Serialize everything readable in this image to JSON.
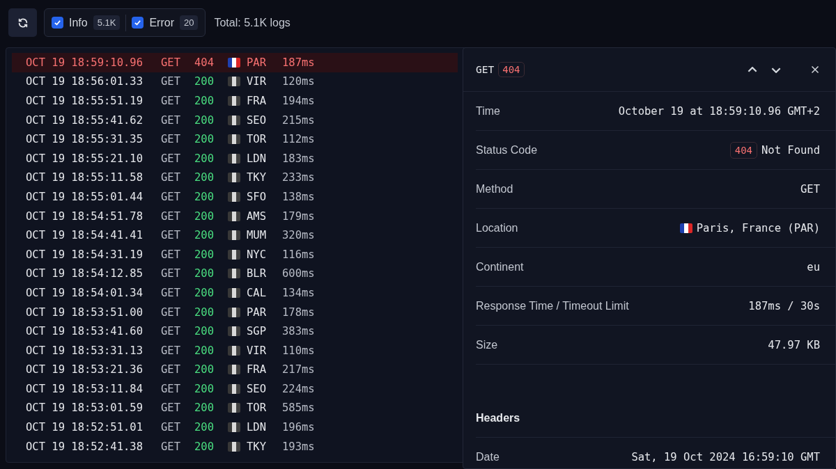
{
  "toolbar": {
    "filters": [
      {
        "label": "Info",
        "count": "5.1K",
        "checked": true
      },
      {
        "label": "Error",
        "count": "20",
        "checked": true
      }
    ],
    "total": "Total: 5.1K logs"
  },
  "logs": [
    {
      "time": "OCT 19 18:59:10.96",
      "method": "GET",
      "status": "404",
      "location": "PAR",
      "duration": "187ms",
      "kind": "error",
      "selected": true
    },
    {
      "time": "OCT 19 18:56:01.33",
      "method": "GET",
      "status": "200",
      "location": "VIR",
      "duration": "120ms",
      "kind": "info",
      "selected": false
    },
    {
      "time": "OCT 19 18:55:51.19",
      "method": "GET",
      "status": "200",
      "location": "FRA",
      "duration": "194ms",
      "kind": "info",
      "selected": false
    },
    {
      "time": "OCT 19 18:55:41.62",
      "method": "GET",
      "status": "200",
      "location": "SEO",
      "duration": "215ms",
      "kind": "info",
      "selected": false
    },
    {
      "time": "OCT 19 18:55:31.35",
      "method": "GET",
      "status": "200",
      "location": "TOR",
      "duration": "112ms",
      "kind": "info",
      "selected": false
    },
    {
      "time": "OCT 19 18:55:21.10",
      "method": "GET",
      "status": "200",
      "location": "LDN",
      "duration": "183ms",
      "kind": "info",
      "selected": false
    },
    {
      "time": "OCT 19 18:55:11.58",
      "method": "GET",
      "status": "200",
      "location": "TKY",
      "duration": "233ms",
      "kind": "info",
      "selected": false
    },
    {
      "time": "OCT 19 18:55:01.44",
      "method": "GET",
      "status": "200",
      "location": "SFO",
      "duration": "138ms",
      "kind": "info",
      "selected": false
    },
    {
      "time": "OCT 19 18:54:51.78",
      "method": "GET",
      "status": "200",
      "location": "AMS",
      "duration": "179ms",
      "kind": "info",
      "selected": false
    },
    {
      "time": "OCT 19 18:54:41.41",
      "method": "GET",
      "status": "200",
      "location": "MUM",
      "duration": "320ms",
      "kind": "info",
      "selected": false
    },
    {
      "time": "OCT 19 18:54:31.19",
      "method": "GET",
      "status": "200",
      "location": "NYC",
      "duration": "116ms",
      "kind": "info",
      "selected": false
    },
    {
      "time": "OCT 19 18:54:12.85",
      "method": "GET",
      "status": "200",
      "location": "BLR",
      "duration": "600ms",
      "kind": "info",
      "selected": false
    },
    {
      "time": "OCT 19 18:54:01.34",
      "method": "GET",
      "status": "200",
      "location": "CAL",
      "duration": "134ms",
      "kind": "info",
      "selected": false
    },
    {
      "time": "OCT 19 18:53:51.00",
      "method": "GET",
      "status": "200",
      "location": "PAR",
      "duration": "178ms",
      "kind": "info",
      "selected": false
    },
    {
      "time": "OCT 19 18:53:41.60",
      "method": "GET",
      "status": "200",
      "location": "SGP",
      "duration": "383ms",
      "kind": "info",
      "selected": false
    },
    {
      "time": "OCT 19 18:53:31.13",
      "method": "GET",
      "status": "200",
      "location": "VIR",
      "duration": "110ms",
      "kind": "info",
      "selected": false
    },
    {
      "time": "OCT 19 18:53:21.36",
      "method": "GET",
      "status": "200",
      "location": "FRA",
      "duration": "217ms",
      "kind": "info",
      "selected": false
    },
    {
      "time": "OCT 19 18:53:11.84",
      "method": "GET",
      "status": "200",
      "location": "SEO",
      "duration": "224ms",
      "kind": "info",
      "selected": false
    },
    {
      "time": "OCT 19 18:53:01.59",
      "method": "GET",
      "status": "200",
      "location": "TOR",
      "duration": "585ms",
      "kind": "info",
      "selected": false
    },
    {
      "time": "OCT 19 18:52:51.01",
      "method": "GET",
      "status": "200",
      "location": "LDN",
      "duration": "196ms",
      "kind": "info",
      "selected": false
    },
    {
      "time": "OCT 19 18:52:41.38",
      "method": "GET",
      "status": "200",
      "location": "TKY",
      "duration": "193ms",
      "kind": "info",
      "selected": false
    }
  ],
  "detail": {
    "method": "GET",
    "status": "404",
    "fields": [
      {
        "kind": "text",
        "label": "Time",
        "value": "October 19 at 18:59:10.96 GMT+2"
      },
      {
        "kind": "status",
        "label": "Status Code",
        "badge": "404",
        "value": "Not Found"
      },
      {
        "kind": "text",
        "label": "Method",
        "value": "GET"
      },
      {
        "kind": "location",
        "label": "Location",
        "value": "Paris, France (PAR)"
      },
      {
        "kind": "text",
        "label": "Continent",
        "value": "eu"
      },
      {
        "kind": "text",
        "label": "Response Time / Timeout Limit",
        "value": "187ms / 30s"
      },
      {
        "kind": "text",
        "label": "Size",
        "value": "47.97 KB"
      }
    ],
    "headers_title": "Headers",
    "headers": [
      {
        "label": "Date",
        "value": "Sat, 19 Oct 2024 16:59:10 GMT"
      }
    ]
  }
}
